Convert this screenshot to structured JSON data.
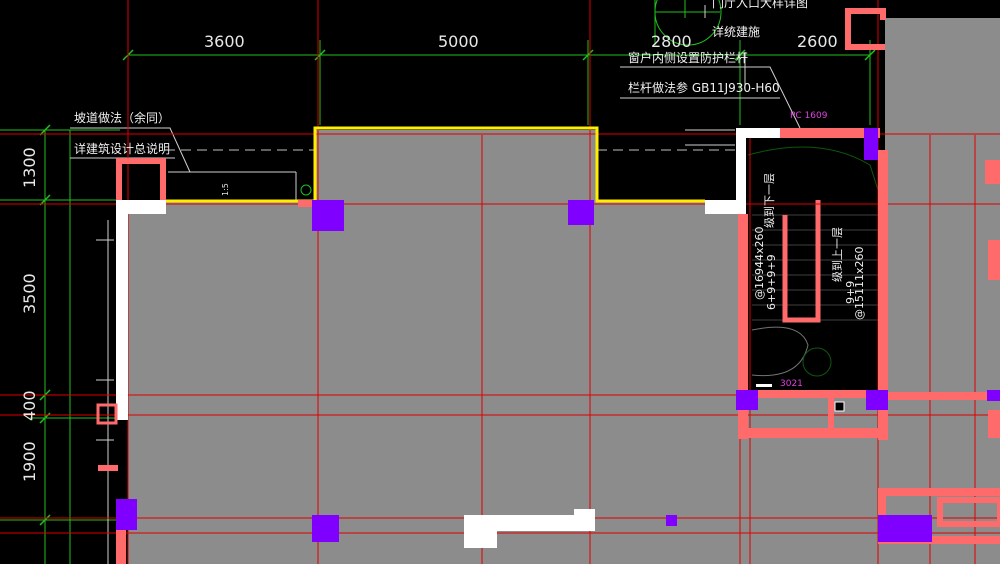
{
  "dimensions": {
    "top": [
      "3600",
      "5000",
      "2800",
      "2600"
    ],
    "left": [
      "1300",
      "3500",
      "400",
      "1900"
    ]
  },
  "notes": {
    "ramp": "坡道做法（余同）",
    "general": "详建筑设计总说明",
    "entrance_detail": "门厅入口大样详图",
    "detail_ref": "详统建施",
    "window_rail": "窗户内侧设置防护栏杆",
    "rail_spec": "栏杆做法参 GB11J930-H60",
    "slope": "1:5"
  },
  "tags": {
    "pc": "PC 1609",
    "door": "3021"
  },
  "stair": {
    "left_down": "级到下一层",
    "left_spec": "@16944x260",
    "left_runs": "6+9+9+9",
    "right_up": "级到上一层",
    "right_spec": "@15111x260",
    "right_runs": "9+9"
  },
  "colors": {
    "background": "#000000",
    "floor": "#8c8c8c",
    "grid": "#e00000",
    "wall": "#ff6b6b",
    "column": "#8000ff",
    "highlight": "#ffee00",
    "dimension": "#20c020"
  }
}
